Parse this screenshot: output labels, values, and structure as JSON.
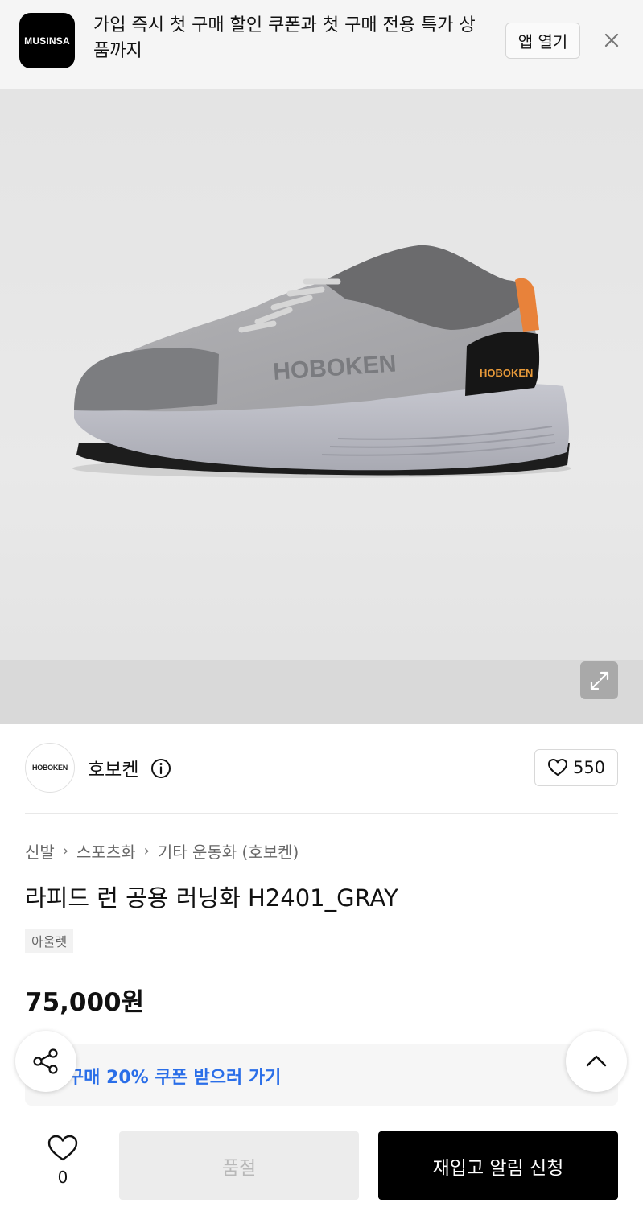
{
  "banner": {
    "app_logo_text": "MUSINSA",
    "message": "가입 즉시 첫 구매 할인 쿠폰과 첫 구매 전용 특가 상품까지",
    "open_app_label": "앱 열기",
    "close_icon": "close-icon"
  },
  "product_image": {
    "shoe_brand_text": "HOBOKEN",
    "expand_icon": "expand-icon"
  },
  "brand": {
    "logo_text": "HOBOKEN",
    "name": "호보켄",
    "info_icon": "info-icon",
    "like_count": "550"
  },
  "breadcrumb": [
    "신발",
    "스포츠화",
    "기타 운동화 (호보켄)"
  ],
  "product": {
    "title": "라피드 런 공용 러닝화 H2401_GRAY",
    "badge": "아울렛",
    "price": "75,000원"
  },
  "coupon": {
    "text": "첫 구매 20% 쿠폰 받으러 가기"
  },
  "bottom_bar": {
    "wish_count": "0",
    "soldout_label": "품절",
    "restock_label": "재입고 알림 신청"
  },
  "colors": {
    "accent_blue": "#2a6ee8",
    "primary_black": "#000000",
    "disabled_gray": "#ececec"
  }
}
